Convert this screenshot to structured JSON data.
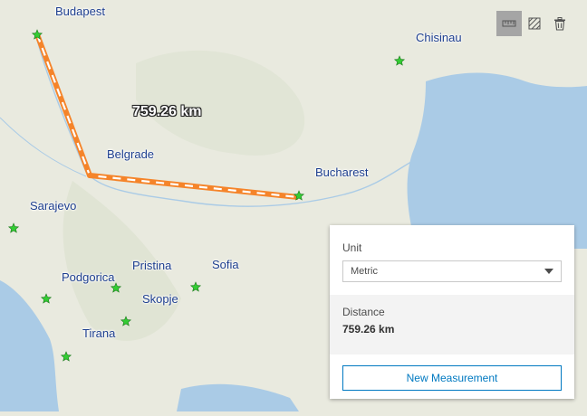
{
  "map": {
    "cities": [
      "Budapest",
      "Chisinau",
      "Belgrade",
      "Bucharest",
      "Sarajevo",
      "Pristina",
      "Sofia",
      "Podgorica",
      "Skopje",
      "Tirana"
    ],
    "measurement_label": "759.26 km",
    "colors": {
      "water": "#aacbe6",
      "land": "#e9eadf",
      "measure_line": "#f5842a",
      "city_label": "#1e3f8f",
      "star": "#33cc33"
    }
  },
  "toolbar": {
    "tools": [
      "distance-tool-icon",
      "area-tool-icon",
      "trash-icon"
    ],
    "active_tool": "distance-tool-icon"
  },
  "panel": {
    "unit_label": "Unit",
    "unit_selected": "Metric",
    "distance_label": "Distance",
    "distance_value": "759.26 km",
    "new_measurement": "New Measurement"
  }
}
